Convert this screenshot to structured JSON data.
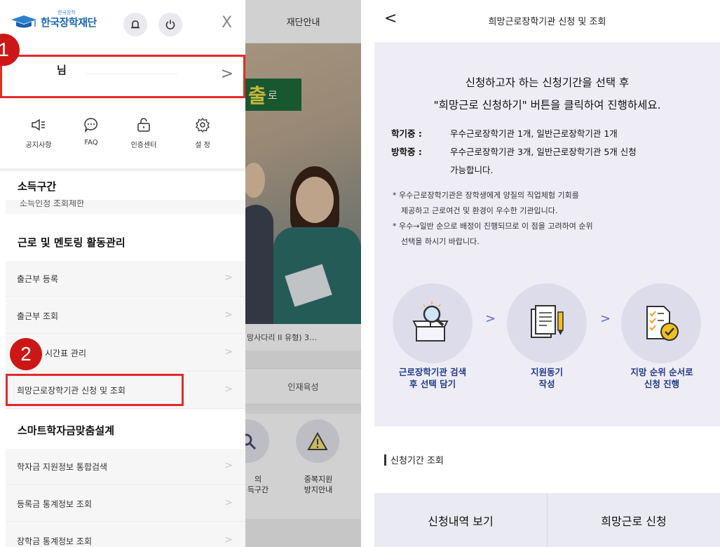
{
  "left": {
    "background_app": {
      "header_label": "재단안내",
      "hero_highlight": "출",
      "hero_suffix": "로",
      "caption": "망사다리 II 유형) 3…",
      "tab_label": "인재육성",
      "icon1_label": "의\n득구간",
      "icon2_label": "중복지원\n방지안내"
    },
    "drawer": {
      "logo_small": "한국장학",
      "logo_text": "한국장학재단",
      "bell_icon": "bell-icon",
      "power_icon": "power-icon",
      "close_label": "X",
      "user_name": "님",
      "user_arrow": ">",
      "badge1": "1",
      "badge2": "2",
      "quick_menu": [
        {
          "icon": "megaphone-icon",
          "glyph": "◁⁝",
          "label": "공지사항"
        },
        {
          "icon": "chat-icon",
          "glyph": "💬",
          "label": "FAQ"
        },
        {
          "icon": "lock-icon",
          "glyph": "🔓",
          "label": "인증센터"
        },
        {
          "icon": "gear-icon",
          "glyph": "⚙",
          "label": "설 정"
        }
      ],
      "sections": {
        "income": "소득구간",
        "income_partial": "소득인정 조회제한",
        "work": "근로 및 멘토링 활동관리",
        "smart": "스마트학자금맞춤설계"
      },
      "work_items": [
        "출근부 등록",
        "출근부 조회",
        "시간표 관리",
        "희망근로장학기관 신청 및 조회"
      ],
      "smart_items": [
        "학자금 지원정보 통합검색",
        "등록금 통계정보 조회",
        "장학금 통계정보 조회"
      ],
      "chevron": ">"
    }
  },
  "right": {
    "back_label": "<",
    "title": "희망근로장학기관 신청 및 조회",
    "panel": {
      "heading_line1": "신청하고자 하는 신청기간을 선택 후",
      "heading_line2": "\"희망근로 신청하기\" 버튼을 클릭하여 진행하세요.",
      "semester_label": "학기중 :",
      "semester_text": "우수근로장학기관 1개, 일반근로장학기관 1개",
      "vacation_label": "방학중 :",
      "vacation_text": "우수근로장학기관 3개, 일반근로장학기관 5개 신청",
      "vacation_text2": "가능합니다.",
      "note1_line1": "* 우수근로장학기관은 장학생에게 양질의 직업체험 기회를",
      "note1_line2": "제공하고 근로여건 및 환경이 우수한 기관입니다.",
      "note2_line1": "* 우수→일반 순으로 배정이 진행되므로 이 점을 고려하여 순위",
      "note2_line2": "선택을 하시기 바랍니다.",
      "steps": [
        {
          "icon": "box-search-icon",
          "line1": "근로장학기관 검색",
          "line2": "후 선택 담기"
        },
        {
          "icon": "document-pen-icon",
          "line1": "지원동기",
          "line2": "작성"
        },
        {
          "icon": "checklist-icon",
          "line1": "지망 순위 순서로",
          "line2": "신청 진행"
        }
      ],
      "step_arrow": ">"
    },
    "section_title": "신청기간 조회",
    "tabs": [
      "신청내역 보기",
      "희망근로 신청"
    ]
  },
  "colors": {
    "highlight_red": "#e32a2a",
    "badge_red": "#cc1717",
    "panel_bg": "#eeedf6",
    "step_text": "#233a8a",
    "logo_blue": "#1b67b3"
  }
}
